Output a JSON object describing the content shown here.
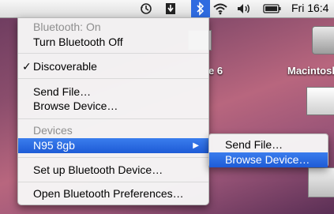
{
  "menubar": {
    "icons": [
      "time-machine-icon",
      "script-icon",
      "bluetooth-icon",
      "wifi-icon",
      "volume-icon",
      "battery-icon"
    ],
    "clock": "Fri 16:4"
  },
  "desktop": {
    "hd_label": "Macintosh",
    "item_label": "e 6"
  },
  "bluetooth_menu": {
    "status": "Bluetooth: On",
    "turn_off": "Turn Bluetooth Off",
    "discoverable": "Discoverable",
    "discoverable_check": "✓",
    "send_file": "Send File…",
    "browse_device": "Browse Device…",
    "devices_header": "Devices",
    "device_name": "N95 8gb",
    "setup": "Set up Bluetooth Device…",
    "preferences": "Open Bluetooth Preferences…"
  },
  "device_submenu": {
    "send_file": "Send File…",
    "browse_device": "Browse Device…"
  },
  "colors": {
    "selection": "#2f6be0",
    "menu_bg": "#f6f6f6"
  }
}
